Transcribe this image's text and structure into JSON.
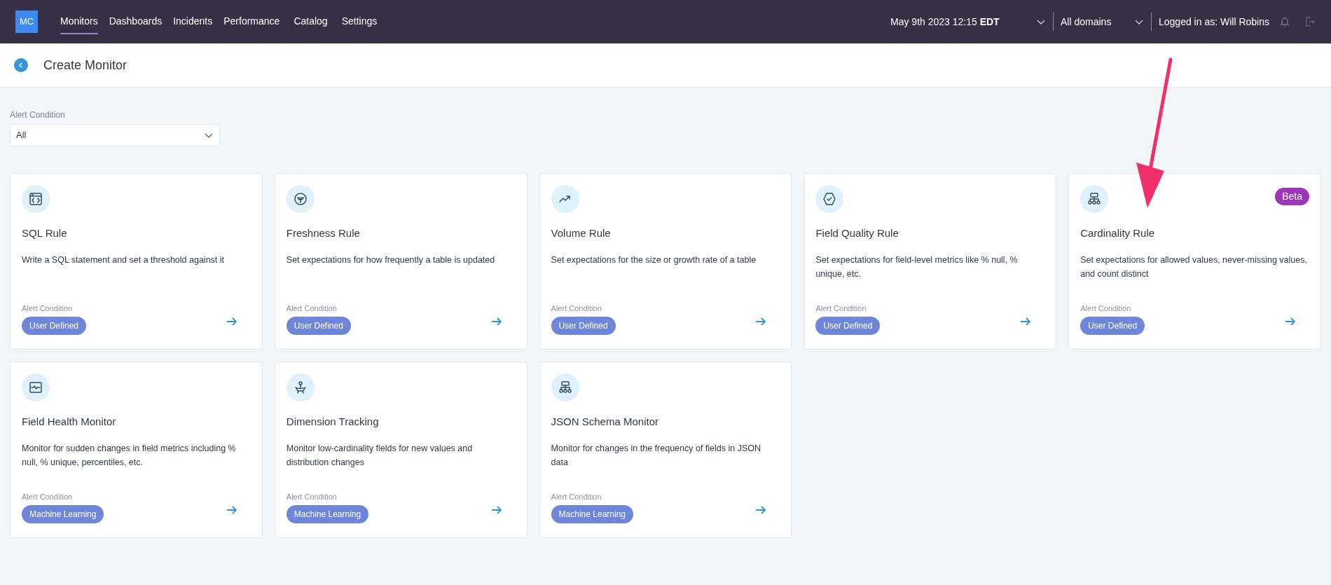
{
  "header": {
    "logo": "MC",
    "nav": [
      {
        "label": "Monitors",
        "selected": true
      },
      {
        "label": "Dashboards",
        "selected": false
      },
      {
        "label": "Incidents",
        "selected": false
      },
      {
        "label": "Performance",
        "selected": false
      },
      {
        "label": "Catalog",
        "selected": false
      },
      {
        "label": "Settings",
        "selected": false
      }
    ],
    "date": "May 9th 2023 12:15 **EDT**",
    "domain": "All domains",
    "user": "Logged in as: Will Robins"
  },
  "page_title": "Create Monitor",
  "filter": {
    "label": "Alert Condition",
    "value": "All"
  },
  "cards": [
    {
      "title": "SQL Rule",
      "description": "Write a SQL statement and set a threshold against it",
      "condition_label": "Alert Condition",
      "condition": "User Defined"
    },
    {
      "title": "Freshness Rule",
      "description": "Set expectations for how frequently a table is updated",
      "condition_label": "Alert Condition",
      "condition": "User Defined"
    },
    {
      "title": "Volume Rule",
      "description": "Set expectations for the size or growth rate of a table",
      "condition_label": "Alert Condition",
      "condition": "User Defined"
    },
    {
      "title": "Field Quality Rule",
      "description": "Set expectations for field-level metrics like % null, % unique, etc.",
      "condition_label": "Alert Condition",
      "condition": "User Defined"
    },
    {
      "title": "Cardinality Rule",
      "badge": "Beta",
      "description": "Set expectations for allowed values, never-missing values, and count distinct",
      "condition_label": "Alert Condition",
      "condition": "User Defined"
    },
    {
      "title": "Field Health Monitor",
      "description": "Monitor for sudden changes in field metrics including % null, % unique, percentiles, etc.",
      "condition_label": "Alert Condition",
      "condition": "Machine Learning"
    },
    {
      "title": "Dimension Tracking",
      "description": "Monitor low-cardinality fields for new values and distribution changes",
      "condition_label": "Alert Condition",
      "condition": "Machine Learning"
    },
    {
      "title": "JSON Schema Monitor",
      "description": "Monitor for changes in the frequency of fields in JSON data",
      "condition_label": "Alert Condition",
      "condition": "Machine Learning"
    }
  ]
}
